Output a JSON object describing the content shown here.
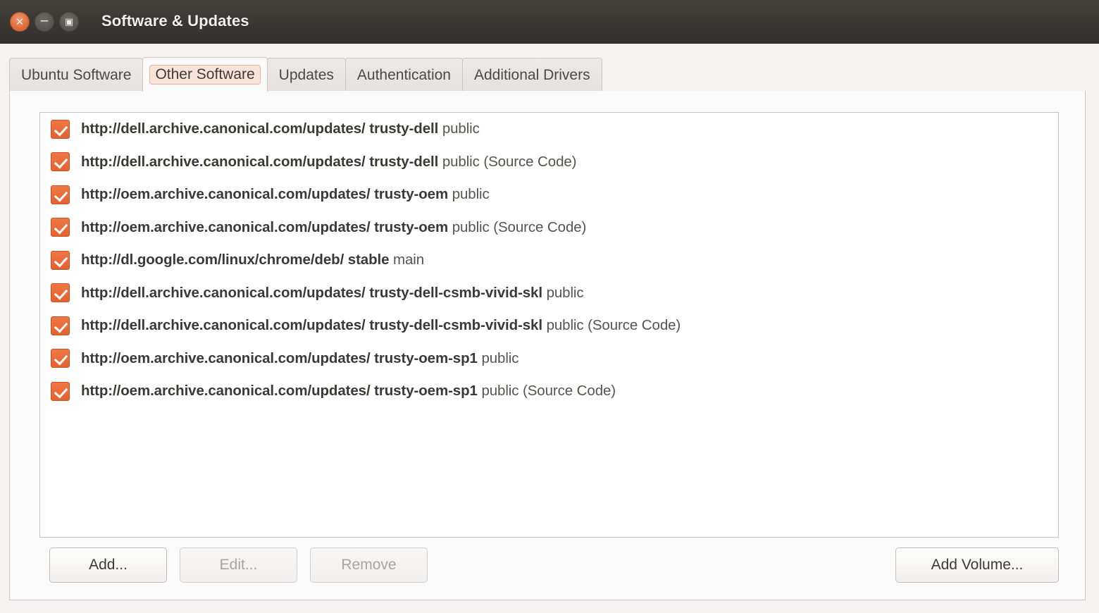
{
  "window": {
    "title": "Software & Updates",
    "controls": [
      {
        "name": "close",
        "glyph": "✕"
      },
      {
        "name": "minimize",
        "glyph": "−"
      },
      {
        "name": "maximize",
        "glyph": "▣"
      }
    ]
  },
  "tabs": [
    {
      "label": "Ubuntu Software",
      "active": false
    },
    {
      "label": "Other Software",
      "active": true
    },
    {
      "label": "Updates",
      "active": false
    },
    {
      "label": "Authentication",
      "active": false
    },
    {
      "label": "Additional Drivers",
      "active": false
    }
  ],
  "sources": [
    {
      "checked": true,
      "uri": "http://dell.archive.canonical.com/updates/ trusty-dell",
      "component": "public"
    },
    {
      "checked": true,
      "uri": "http://dell.archive.canonical.com/updates/ trusty-dell",
      "component": "public (Source Code)"
    },
    {
      "checked": true,
      "uri": "http://oem.archive.canonical.com/updates/ trusty-oem",
      "component": "public"
    },
    {
      "checked": true,
      "uri": "http://oem.archive.canonical.com/updates/ trusty-oem",
      "component": "public (Source Code)"
    },
    {
      "checked": true,
      "uri": "http://dl.google.com/linux/chrome/deb/ stable",
      "component": "main"
    },
    {
      "checked": true,
      "uri": "http://dell.archive.canonical.com/updates/ trusty-dell-csmb-vivid-skl",
      "component": "public"
    },
    {
      "checked": true,
      "uri": "http://dell.archive.canonical.com/updates/ trusty-dell-csmb-vivid-skl",
      "component": "public (Source Code)"
    },
    {
      "checked": true,
      "uri": "http://oem.archive.canonical.com/updates/ trusty-oem-sp1",
      "component": "public"
    },
    {
      "checked": true,
      "uri": "http://oem.archive.canonical.com/updates/ trusty-oem-sp1",
      "component": "public (Source Code)"
    }
  ],
  "buttons": {
    "add": "Add...",
    "edit": "Edit...",
    "remove": "Remove",
    "add_volume": "Add Volume..."
  },
  "colors": {
    "titlebar": "#3a3733",
    "accent_orange": "#e4622f",
    "tab_focus_fill": "#f8e3d8",
    "tab_focus_border": "#e8b79a",
    "panel_bg": "#fbfafa",
    "list_bg": "#ffffff"
  }
}
